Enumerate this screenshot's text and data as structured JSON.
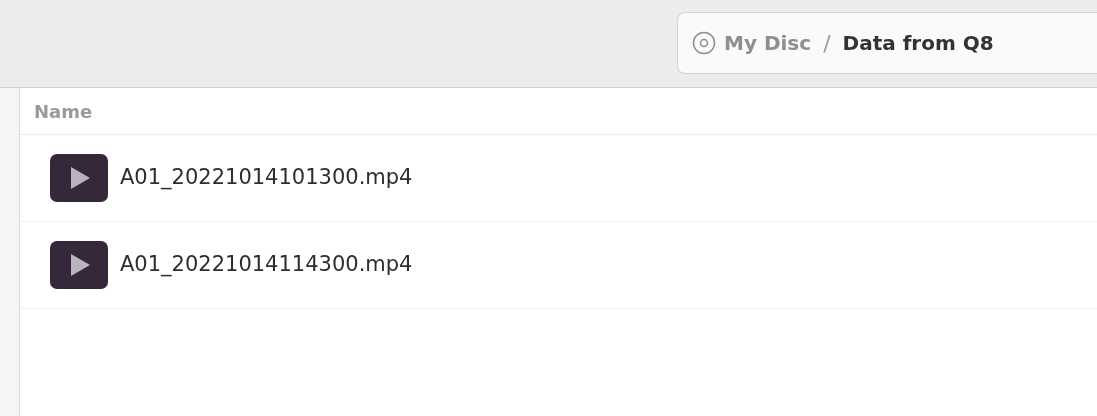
{
  "breadcrumb": [
    {
      "label": "My Disc",
      "current": false
    },
    {
      "label": "Data from Q8",
      "current": true
    }
  ],
  "breadcrumb_separator": "/",
  "table": {
    "columns": [
      "Name"
    ],
    "rows": [
      {
        "name": "A01_20221014101300.mp4"
      },
      {
        "name": "A01_20221014114300.mp4"
      }
    ]
  }
}
